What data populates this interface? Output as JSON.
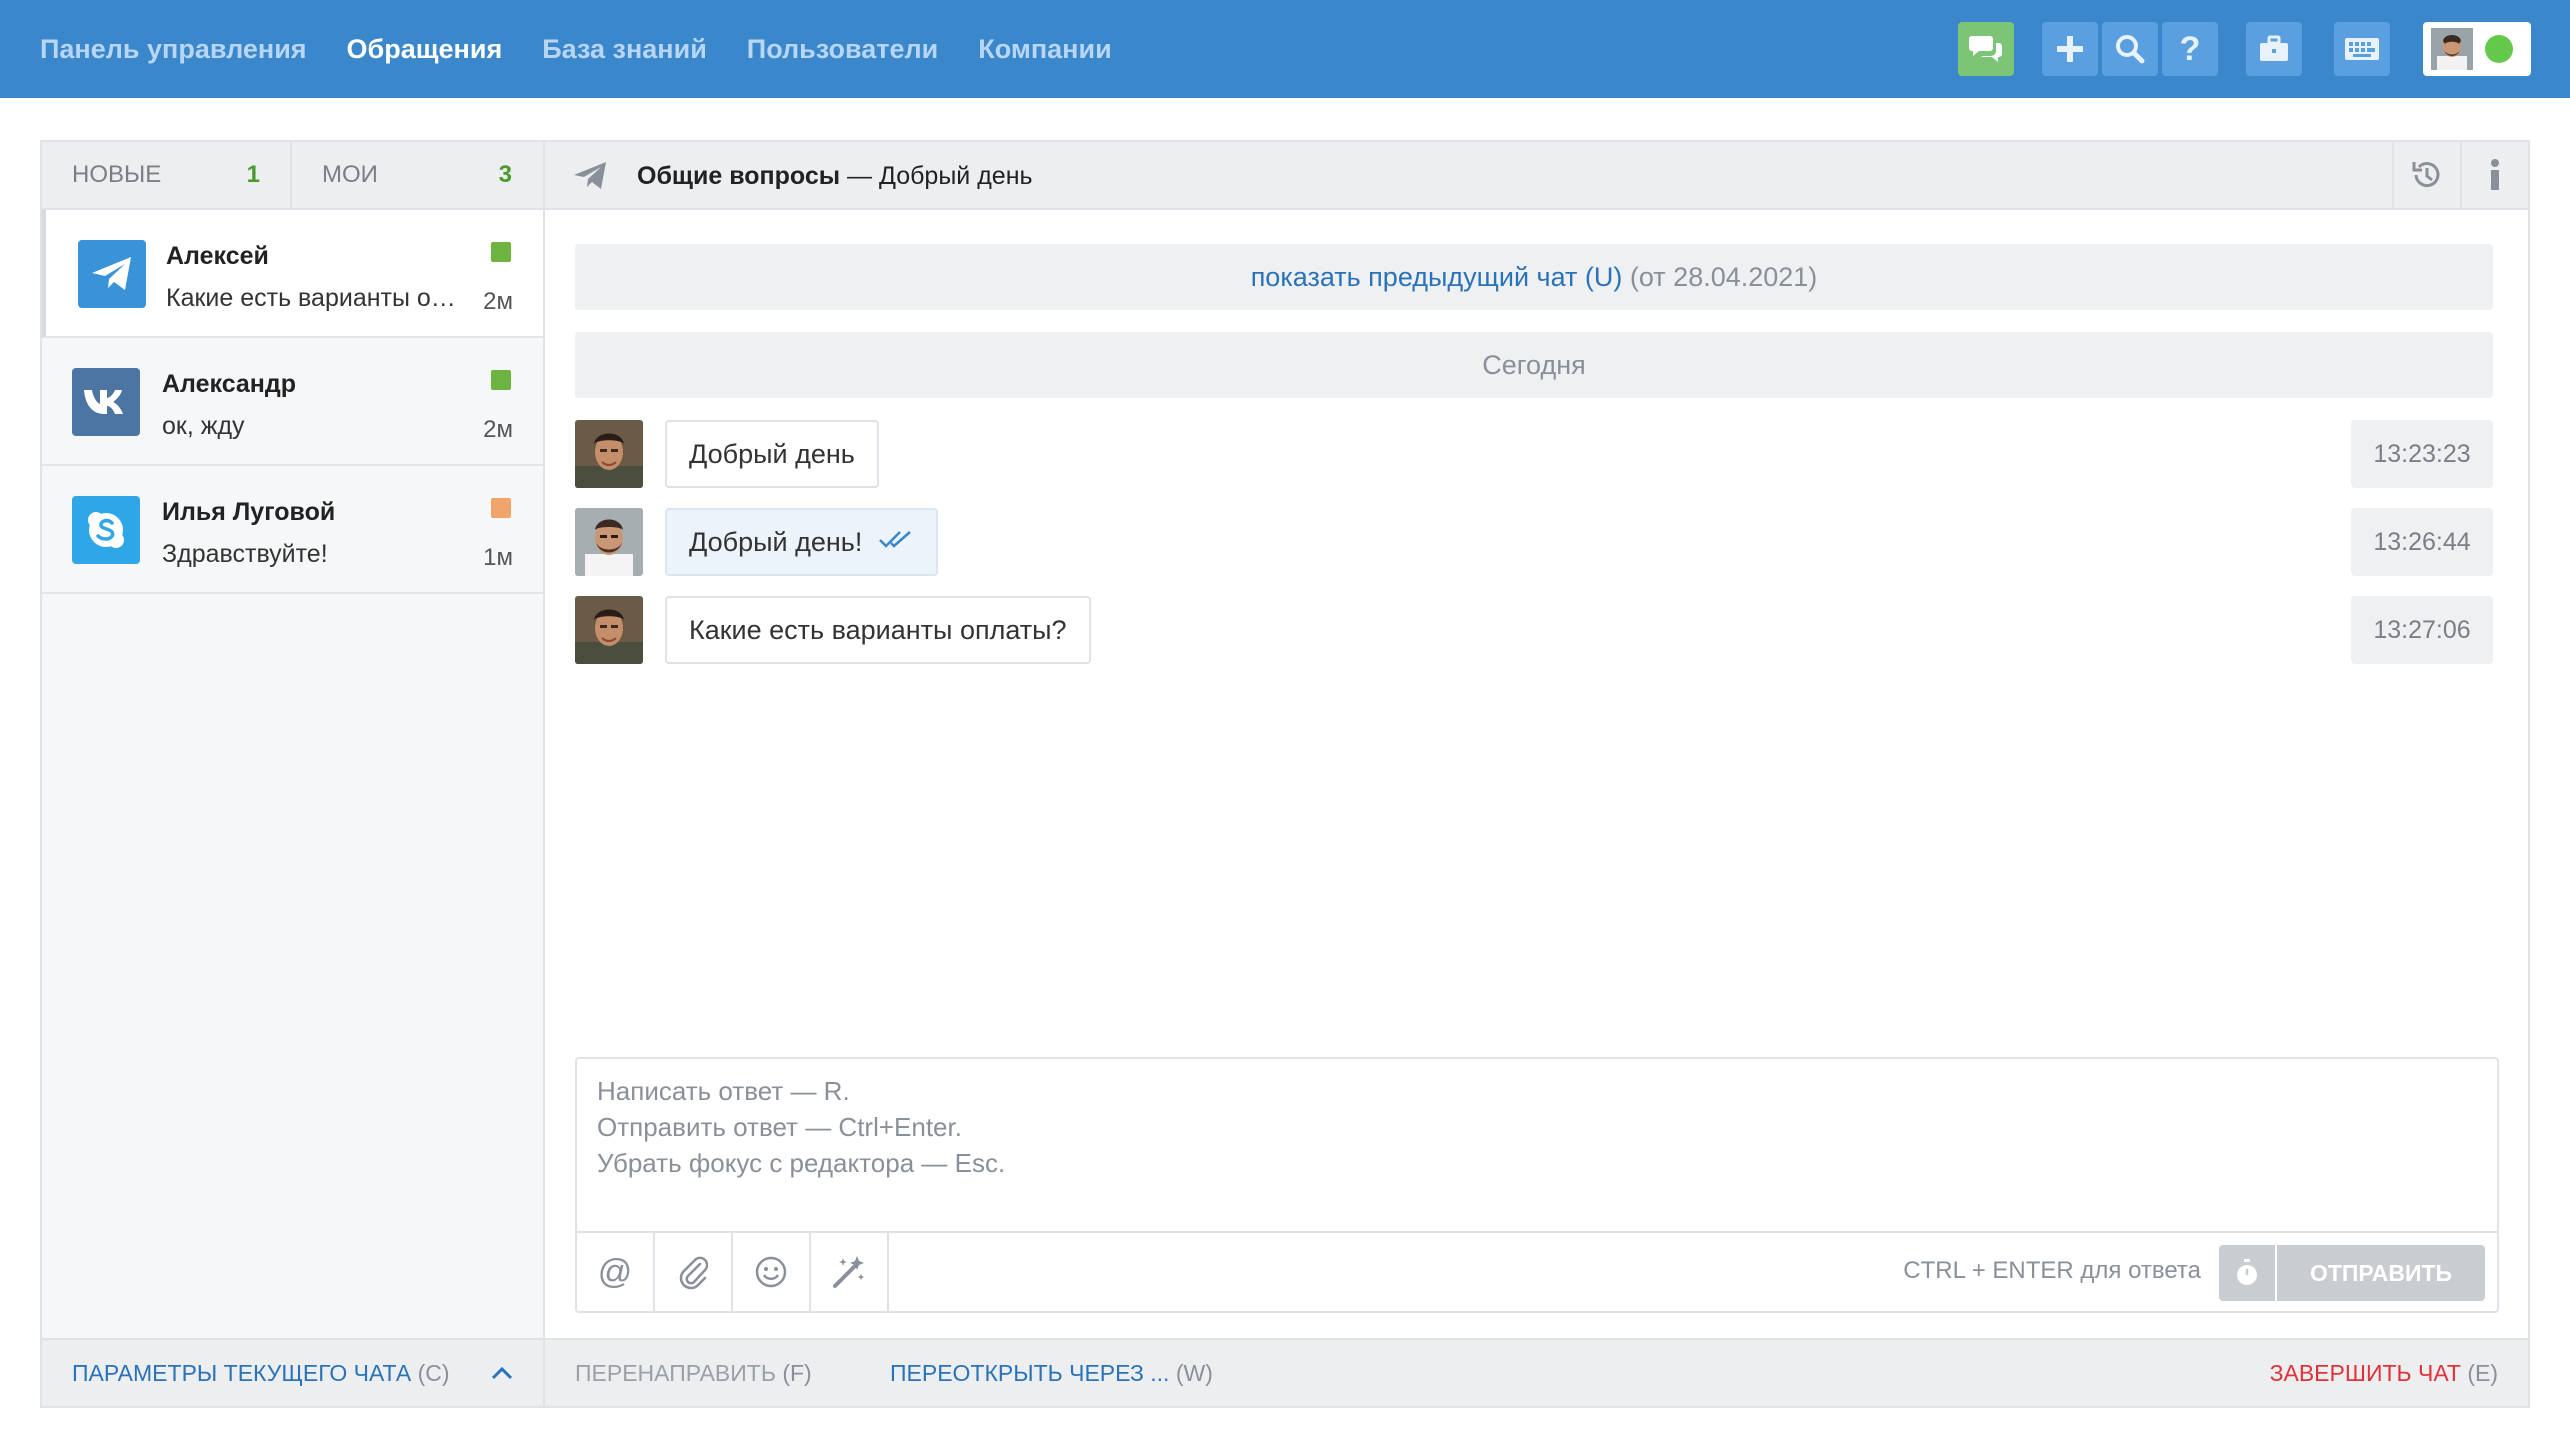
{
  "nav": {
    "items": [
      "Панель управления",
      "Обращения",
      "База знаний",
      "Пользователи",
      "Компании"
    ],
    "active_index": 1
  },
  "toolbar_icons": [
    "chat-bubbles-icon",
    "plus-icon",
    "search-icon",
    "question-icon",
    "briefcase-icon",
    "keyboard-icon"
  ],
  "user_status_color": "#64c84a",
  "tabs": [
    {
      "label": "НОВЫЕ",
      "count": "1"
    },
    {
      "label": "МОИ",
      "count": "3"
    }
  ],
  "chats": [
    {
      "name": "Алексей",
      "preview": "Какие есть варианты оплаты?",
      "ago": "2м",
      "channel": "telegram",
      "status_color": "#6db33f",
      "active": true
    },
    {
      "name": "Александр",
      "preview": "ок, жду",
      "ago": "2м",
      "channel": "vk",
      "status_color": "#6db33f",
      "active": false
    },
    {
      "name": "Илья Луговой",
      "preview": "Здравствуйте!",
      "ago": "1м",
      "channel": "skype",
      "status_color": "#f0a46a",
      "active": false
    }
  ],
  "left_footer": {
    "label": "ПАРАМЕТРЫ ТЕКУЩЕГО ЧАТА",
    "key": "(C)"
  },
  "header": {
    "group": "Общие вопросы",
    "separator": "—",
    "subject": "Добрый день"
  },
  "previous_chat": {
    "link": "показать предыдущий чат (U)",
    "date": "(от 28.04.2021)"
  },
  "date_divider": "Сегодня",
  "messages": [
    {
      "text": "Добрый день",
      "time": "13:23:23",
      "own": false
    },
    {
      "text": "Добрый день!",
      "time": "13:26:44",
      "own": true
    },
    {
      "text": "Какие есть варианты оплаты?",
      "time": "13:27:06",
      "own": false
    }
  ],
  "editor": {
    "placeholder_lines": [
      "Написать ответ — R.",
      "Отправить ответ — Ctrl+Enter.",
      "Убрать фокус с редактора — Esc."
    ],
    "hint": "CTRL + ENTER для ответа",
    "send_label": "ОТПРАВИТЬ"
  },
  "footer": {
    "redirect": {
      "label": "ПЕРЕНАПРАВИТЬ",
      "key": "(F)"
    },
    "reopen": {
      "label": "ПЕРЕОТКРЫТЬ ЧЕРЕЗ ...",
      "key": "(W)"
    },
    "finish": {
      "label": "ЗАВЕРШИТЬ ЧАТ",
      "key": "(E)"
    }
  },
  "colors": {
    "topbar": "#3a87cc",
    "link": "#2a73b8",
    "danger": "#e0323a",
    "counter": "#4a9a2e"
  }
}
